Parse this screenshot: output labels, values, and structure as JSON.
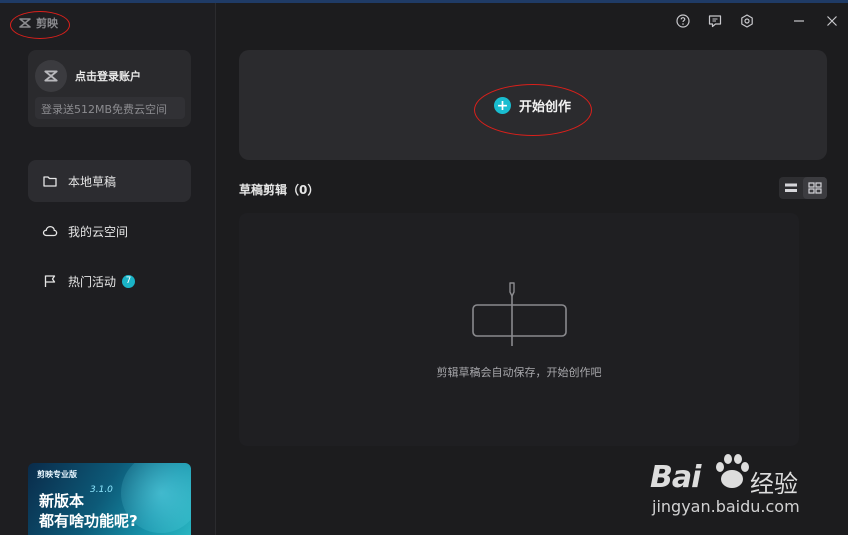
{
  "app": {
    "name": "剪映"
  },
  "account": {
    "login_prompt": "点击登录账户",
    "cloud_offer": "登录送512MB免费云空间"
  },
  "sidebar": {
    "items": [
      {
        "label": "本地草稿",
        "icon": "folder-icon",
        "active": true
      },
      {
        "label": "我的云空间",
        "icon": "cloud-icon",
        "active": false
      },
      {
        "label": "热门活动",
        "icon": "flag-icon",
        "active": false,
        "badge": "7"
      }
    ]
  },
  "promo": {
    "brand": "剪映专业版",
    "version": "3.1.0",
    "line1": "新版本",
    "line2": "都有啥功能呢?"
  },
  "topbar": {
    "icons": [
      "help-icon",
      "feedback-icon",
      "settings-icon",
      "minimize-icon",
      "close-icon"
    ]
  },
  "main": {
    "create_label": "开始创作",
    "drafts_title": "草稿剪辑（0）",
    "empty_message": "剪辑草稿会自动保存，开始创作吧"
  },
  "watermark": {
    "brand_left": "Bai",
    "brand_right": "经验",
    "url": "jingyan.baidu.com"
  },
  "colors": {
    "accent": "#19bdd0",
    "annotation": "#d9201b",
    "background": "#1c1c1e"
  }
}
